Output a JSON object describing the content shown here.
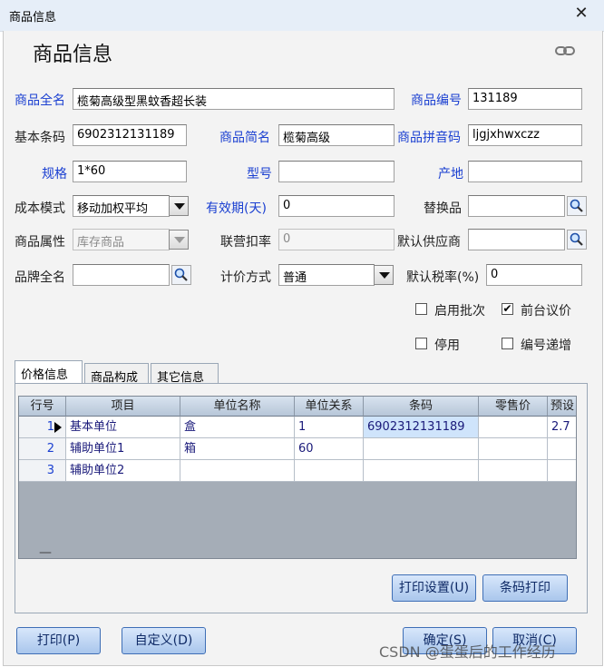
{
  "window": {
    "title": "商品信息"
  },
  "page": {
    "heading": "商品信息"
  },
  "form": {
    "full_name": {
      "label": "商品全名",
      "value": "榄菊高级型黑蚊香超长装"
    },
    "code": {
      "label": "商品编号",
      "value": "131189"
    },
    "barcode": {
      "label": "基本条码",
      "value": "6902312131189"
    },
    "short_name": {
      "label": "商品简名",
      "value": "榄菊高级"
    },
    "pinyin": {
      "label": "商品拼音码",
      "value": "ljgjxhwxczz"
    },
    "spec": {
      "label": "规格",
      "value": "1*60"
    },
    "model": {
      "label": "型号",
      "value": ""
    },
    "origin": {
      "label": "产地",
      "value": ""
    },
    "cost_mode": {
      "label": "成本模式",
      "value": "移动加权平均"
    },
    "shelf_life": {
      "label": "有效期(天)",
      "value": "0"
    },
    "substitute": {
      "label": "替换品",
      "value": ""
    },
    "attribute": {
      "label": "商品属性",
      "value": "库存商品"
    },
    "joint_discount": {
      "label": "联营扣率",
      "value": "0"
    },
    "default_supplier": {
      "label": "默认供应商",
      "value": ""
    },
    "brand": {
      "label": "品牌全名",
      "value": ""
    },
    "pricing": {
      "label": "计价方式",
      "value": "普通"
    },
    "tax_rate": {
      "label": "默认税率(%)",
      "value": "0"
    }
  },
  "options": {
    "batch": {
      "label": "启用批次",
      "checked": false
    },
    "counter_price": {
      "label": "前台议价",
      "checked": true
    },
    "disabled": {
      "label": "停用",
      "checked": false
    },
    "auto_increment": {
      "label": "编号递增",
      "checked": false
    }
  },
  "tabs": [
    "价格信息",
    "商品构成",
    "其它信息"
  ],
  "grid": {
    "columns": [
      "行号",
      "项目",
      "单位名称",
      "单位关系",
      "条码",
      "零售价",
      "预设"
    ],
    "rows": [
      {
        "no": "1",
        "item": "基本单位",
        "unit": "盒",
        "relation": "1",
        "barcode": "6902312131189",
        "retail": "",
        "preset": "2.7"
      },
      {
        "no": "2",
        "item": "辅助单位1",
        "unit": "箱",
        "relation": "60",
        "barcode": "",
        "retail": "",
        "preset": ""
      },
      {
        "no": "3",
        "item": "辅助单位2",
        "unit": "",
        "relation": "",
        "barcode": "",
        "retail": "",
        "preset": ""
      }
    ],
    "footer_mark": "—"
  },
  "buttons": {
    "print_settings": "打印设置(U)",
    "barcode_print": "条码打印",
    "print": "打印(P)",
    "customize": "自定义(D)",
    "ok": "确定(S)",
    "cancel": "取消(C)"
  },
  "watermark": "CSDN @蛋蛋后的工作经历",
  "icons": {
    "close": "close-icon",
    "link": "link-icon",
    "lookup": "magnifier-icon",
    "dropdown": "chevron-down-icon",
    "row_pointer": "triangle-right-icon"
  }
}
